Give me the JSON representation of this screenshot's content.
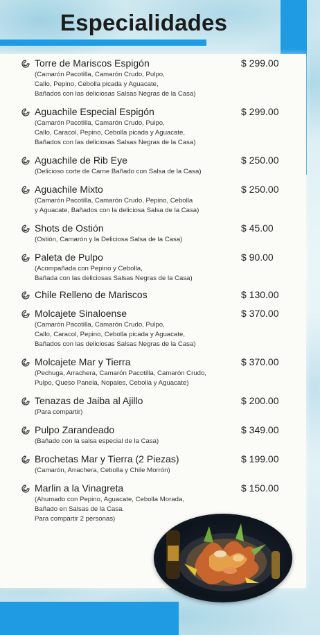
{
  "title": "Especialidades",
  "colors": {
    "accent": "#1f9be4",
    "paper": "#fbfbf8"
  },
  "item_icon": "shell-icon",
  "items": [
    {
      "name": "Torre de Mariscos Espigón",
      "price": "$ 299.00",
      "desc": [
        "(Camarón Pacotilla, Camarón Crudo, Pulpo,",
        "Callo, Pepino, Cebolla picada y Aguacate,",
        "Bañados con las deliciosas Salsas Negras de la Casa)"
      ]
    },
    {
      "name": "Aguachile Especial Espigón",
      "price": "$ 299.00",
      "desc": [
        "(Camarón Pacotilla, Camarón Crudo, Pulpo,",
        "Callo, Caracol, Pepino, Cebolla picada y Aguacate,",
        "Bañados con las deliciosas Salsas Negras de la Casa)"
      ]
    },
    {
      "name": "Aguachile de Rib Eye",
      "price": "$ 250.00",
      "desc": [
        "(Delicioso corte de Carne Bañado con Salsa de la Casa)"
      ]
    },
    {
      "name": "Aguachile Mixto",
      "price": "$ 250.00",
      "desc": [
        "(Camarón Pacotilla, Camarón Crudo, Pepino, Cebolla",
        "y Aguacate, Bañados con la deliciosa Salsa de la Casa)"
      ]
    },
    {
      "name": "Shots de Ostión",
      "price": "$ 45.00",
      "desc": [
        "(Ostión, Camarón y la Deliciosa Salsa de la Casa)"
      ]
    },
    {
      "name": "Paleta de Pulpo",
      "price": "$ 90.00",
      "desc": [
        "(Acompañada con Pepino y Cebolla,",
        "Bañada con las deliciosas Salsas Negras de la Casa)"
      ]
    },
    {
      "name": "Chile Relleno de Mariscos",
      "price": "$ 130.00",
      "desc": []
    },
    {
      "name": "Molcajete Sinaloense",
      "price": "$ 370.00",
      "desc": [
        "(Camarón Pacotilla, Camarón Crudo, Pulpo,",
        "Callo, Caracol, Pepino, Cebolla picada y Aguacate,",
        "Bañados con las deliciosas Salsas Negras de la Casa)"
      ]
    },
    {
      "name": "Molcajete Mar y Tierra",
      "price": "$ 370.00",
      "desc": [
        "(Pechuga, Arrachera, Camarón Pacotilla, Camarón Crudo,",
        "Pulpo, Queso Panela, Nopales, Cebolla y Aguacate)"
      ]
    },
    {
      "name": "Tenazas de Jaiba al Ajillo",
      "price": "$ 200.00",
      "desc": [
        "(Para compartir)"
      ]
    },
    {
      "name": "Pulpo Zarandeado",
      "price": "$ 349.00",
      "desc": [
        "(Bañado con la salsa especial de la Casa)"
      ]
    },
    {
      "name": "Brochetas Mar y Tierra (2 Piezas)",
      "price": "$ 199.00",
      "desc": [
        "(Camarón, Arrachera, Cebolla y Chile Morrón)"
      ]
    },
    {
      "name": "Marlin a la Vinagreta",
      "price": "$ 150.00",
      "desc": [
        "(Ahumado con Pepino, Aguacate, Cebolla Morada,",
        "Bañado en Salsas de la Casa.",
        "Para compartir 2 personas)"
      ]
    }
  ]
}
